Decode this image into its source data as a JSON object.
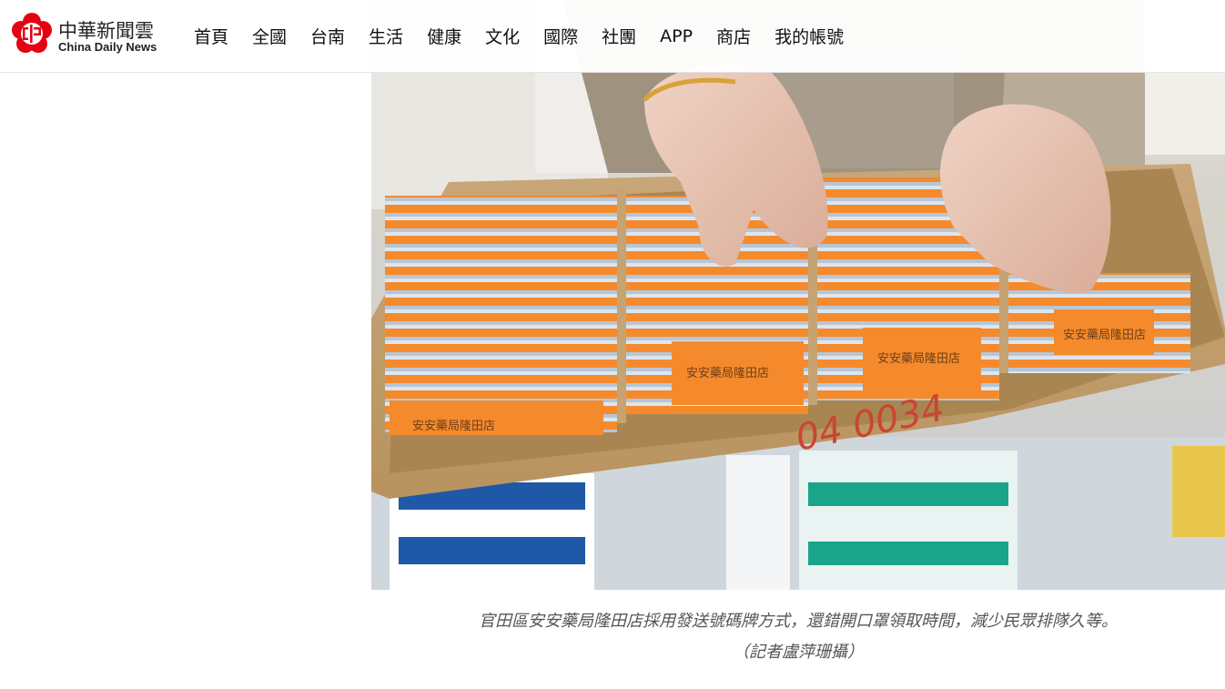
{
  "brand": {
    "name_zh": "中華新聞雲",
    "name_en": "China Daily News",
    "logo_icon": "plum-blossom-cdn-logo",
    "logo_color": "#e60012"
  },
  "nav": {
    "items": [
      {
        "label": "首頁"
      },
      {
        "label": "全國"
      },
      {
        "label": "台南"
      },
      {
        "label": "生活"
      },
      {
        "label": "健康"
      },
      {
        "label": "文化"
      },
      {
        "label": "國際"
      },
      {
        "label": "社團"
      },
      {
        "label": "APP"
      },
      {
        "label": "商店"
      },
      {
        "label": "我的帳號"
      }
    ]
  },
  "photo": {
    "card_label": "安安藥局隆田店",
    "box_handwriting": "04 0034"
  },
  "caption": {
    "line1": "官田區安安藥局隆田店採用發送號碼牌方式，還錯開口罩領取時間，減少民眾排隊久等。",
    "line2": "（記者盧萍珊攝）"
  }
}
